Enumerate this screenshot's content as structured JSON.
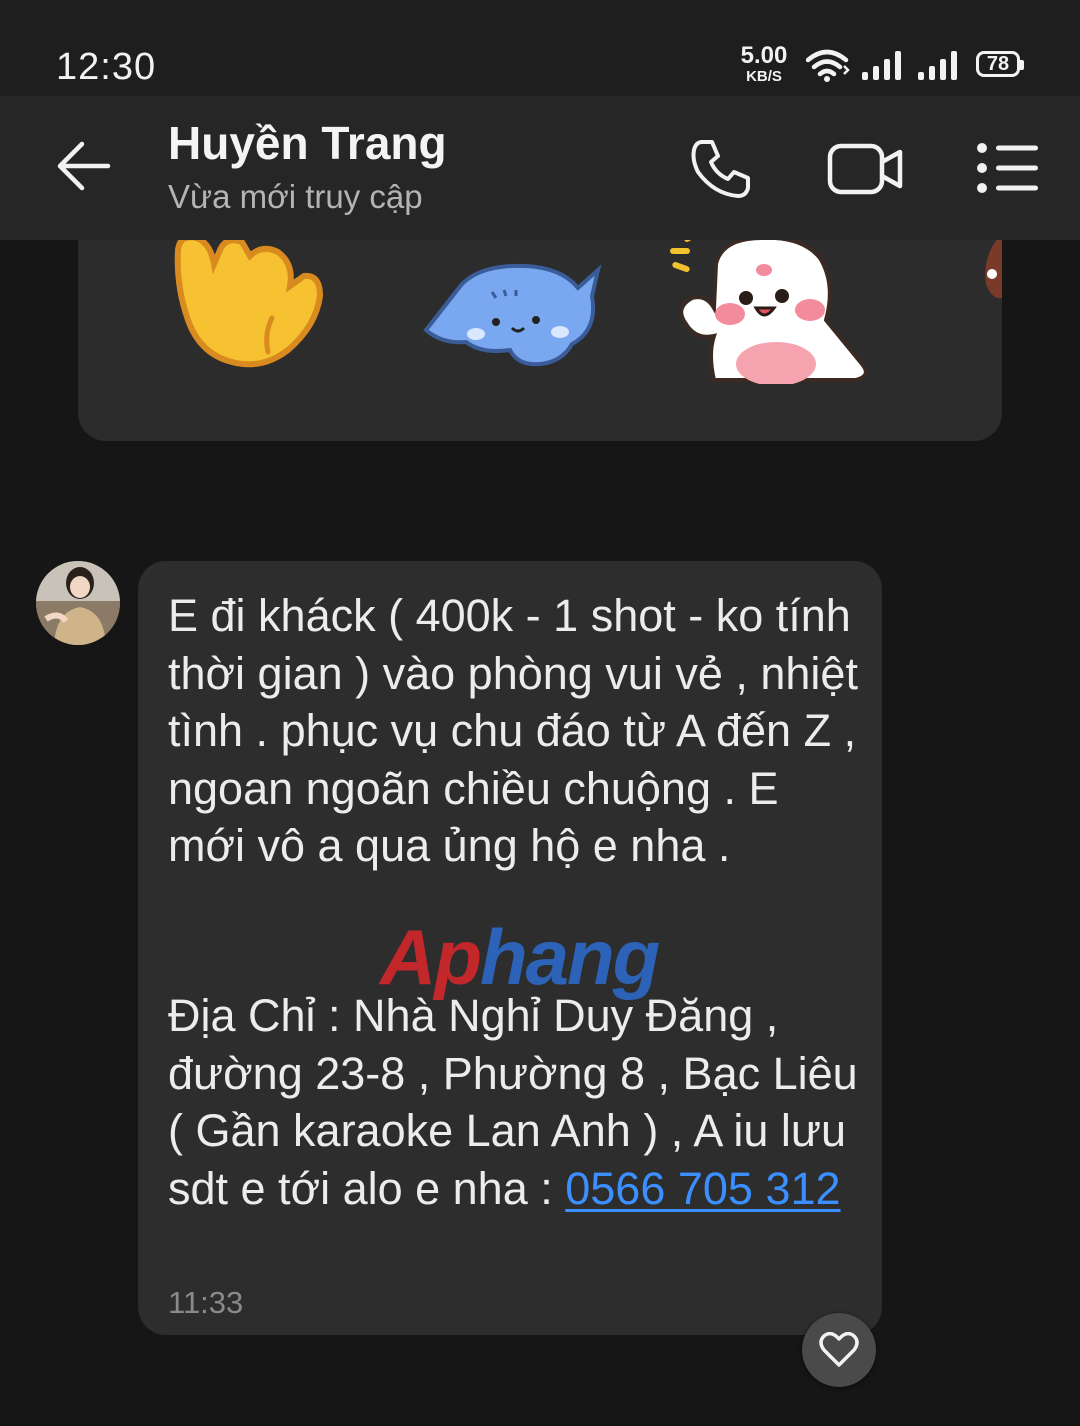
{
  "status_bar": {
    "time": "12:30",
    "net_speed_value": "5.00",
    "net_speed_unit": "KB/S",
    "battery": "78"
  },
  "header": {
    "contact_name": "Huyền Trang",
    "contact_status": "Vừa mới truy cập",
    "icons": [
      "back-arrow-icon",
      "phone-icon",
      "video-camera-icon",
      "list-menu-icon"
    ]
  },
  "message": {
    "text": "E đi kháck ( 400k - 1 shot - ko tính thời gian ) vào phòng vui vẻ , nhiệt tình . phục vụ chu đáo từ A đến Z , ngoan ngoãn chiều chuộng . E mới vô a qua ủng hộ e nha .",
    "address": "Địa Chỉ : Nhà Nghỉ Duy Đăng , đường 23-8 , Phường 8 , Bạc Liêu ( Gần karaoke Lan Anh ) , A iu lưu sdt e tới alo e nha : ",
    "phone": "0566 705 312",
    "time": "11:33"
  },
  "watermark": {
    "part1": "Ap",
    "part2": "hang"
  },
  "colors": {
    "background": "#161616",
    "header": "#262626",
    "bubble": "#2d2d2d",
    "link": "#3b8fff"
  }
}
